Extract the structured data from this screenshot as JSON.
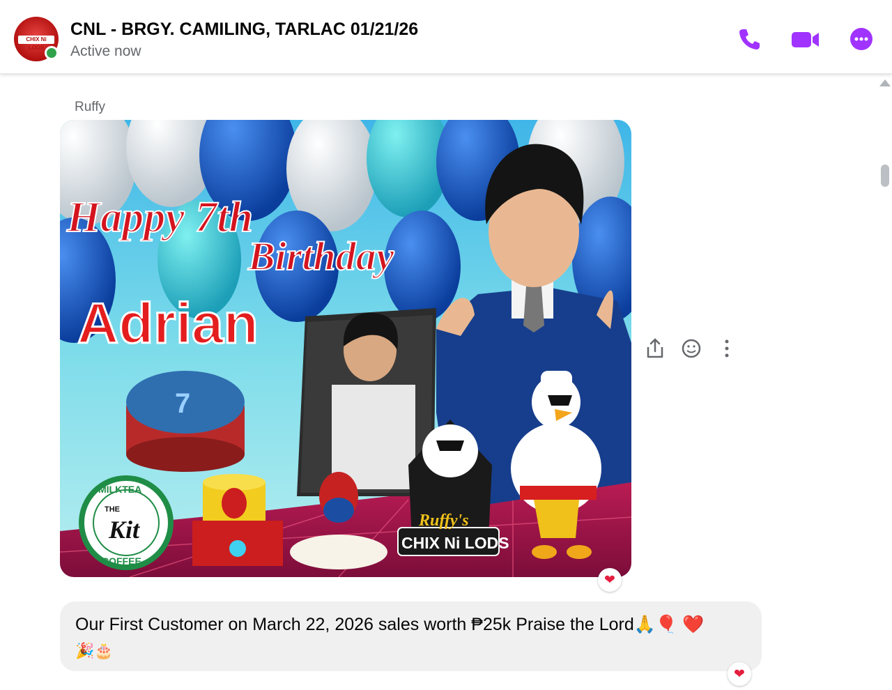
{
  "header": {
    "title": "CNL - BRGY. CAMILING, TARLAC 01/21/26",
    "status": "Active now",
    "avatar_logo_text": "CHIX Ni LODS",
    "accent_color": "#a033ff",
    "icons": [
      "phone-icon",
      "video-camera-icon",
      "more-options-icon"
    ]
  },
  "message_photo": {
    "sender": "Ruffy",
    "greeting_line1": "Happy 7th",
    "greeting_line2": "Birthday",
    "name": "Adrian",
    "logo_left_top": "MILKTEA",
    "logo_left_mid": "THE",
    "logo_left_script": "Kit",
    "logo_left_bottom": "COFFEE",
    "logo_right_top": "Ruffy's",
    "logo_right_bottom": "CHIX Ni LODS",
    "reaction": "❤"
  },
  "message_actions": [
    "share-icon",
    "emoji-react-icon",
    "more-vertical-icon"
  ],
  "message_text": {
    "line1": "Our First Customer  on March 22, 2026 sales worth ₱25k Praise the Lord🙏🎈 ❤️",
    "line2": "🎉🎂",
    "reaction": "❤"
  }
}
